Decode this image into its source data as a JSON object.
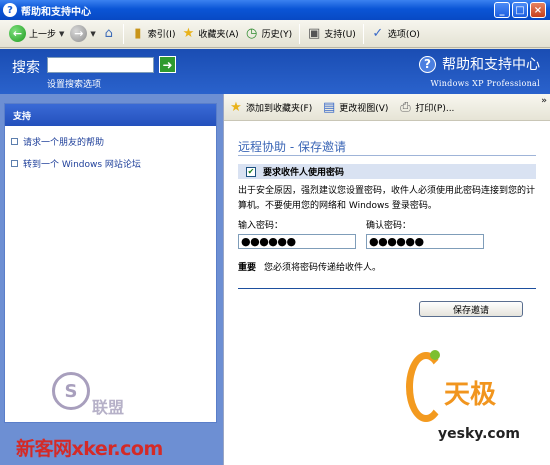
{
  "window": {
    "title": "帮助和支持中心",
    "icon": "help-icon"
  },
  "toolbar": {
    "back_label": "上一步",
    "index_label": "索引(I)",
    "favorites_label": "收藏夹(A)",
    "history_label": "历史(Y)",
    "support_label": "支持(U)",
    "options_label": "选项(O)"
  },
  "header": {
    "search_label": "搜索",
    "search_value": "",
    "search_options": "设置搜索选项",
    "help_title": "帮助和支持中心",
    "edition": "Windows XP Professional"
  },
  "sidebar": {
    "title": "支持",
    "items": [
      {
        "label": "请求一个朋友的帮助"
      },
      {
        "label": "转到一个 Windows 网站论坛"
      }
    ]
  },
  "content_toolbar": {
    "add_favorite": "添加到收藏夹(F)",
    "change_view": "更改视图(V)",
    "print": "打印(P)..."
  },
  "content": {
    "title": "远程协助 - 保存邀请",
    "require_password_label": "要求收件人使用密码",
    "require_password_checked": true,
    "description": "出于安全原因，强烈建议您设置密码，收件人必须使用此密码连接到您的计算机。不要使用您的网络和 Windows 登录密码。",
    "password_label": "输入密码：",
    "password_value": "●●●●●●",
    "confirm_label": "确认密码：",
    "confirm_value": "●●●●●●",
    "important_label": "重要",
    "important_text": "您必须将密码传递给收件人。",
    "save_button": "保存邀请"
  },
  "watermarks": {
    "left_text": "新客网xker.com",
    "left_badge": "S",
    "left_union": "联盟",
    "right_brand": "天极",
    "right_url": "yesky.com"
  },
  "colors": {
    "titlebar": "#0a55d6",
    "header": "#1a4db3",
    "sidebar_bg": "#6d8fd3",
    "accent_title": "#3b66b6"
  }
}
